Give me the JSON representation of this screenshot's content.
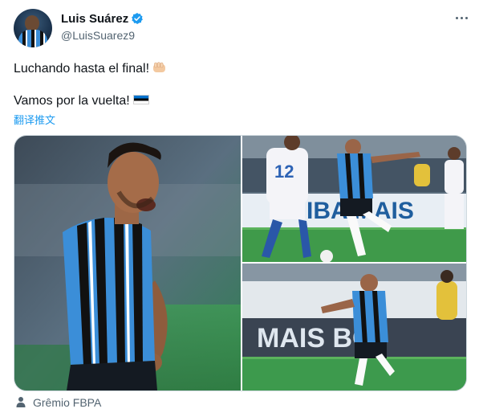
{
  "author": {
    "name": "Luis Suárez",
    "handle": "@LuisSuarez9"
  },
  "tweet": {
    "line1": "Luchando hasta el final!",
    "line2": "Vamos por la vuelta!",
    "translate_link": "翻译推文"
  },
  "media": {
    "photo2_jersey_number": "12",
    "photo2_banner": "IBA MAIS",
    "photo3_banner": "MAIS BO"
  },
  "location": {
    "label": "Grêmio FBPA"
  },
  "colors": {
    "accent": "#1d9bf0",
    "secondary_text": "#536471",
    "verified_badge": "#1d9bf0",
    "gremio_blue": "#3b8ed8"
  }
}
